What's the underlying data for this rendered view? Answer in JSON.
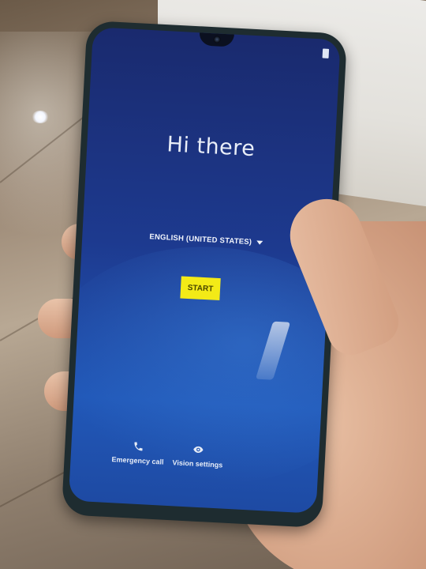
{
  "screen": {
    "greeting": "Hi there",
    "language": "ENGLISH (UNITED STATES)",
    "start_label": "START",
    "emergency_label": "Emergency call",
    "vision_label": "Vision settings"
  },
  "icons": {
    "language_dropdown": "chevron-down-icon",
    "emergency": "phone-icon",
    "vision": "eye-icon"
  },
  "colors": {
    "start_button": "#f3ea17",
    "screen_top": "#1a2a6e",
    "screen_bottom": "#2158b8"
  }
}
